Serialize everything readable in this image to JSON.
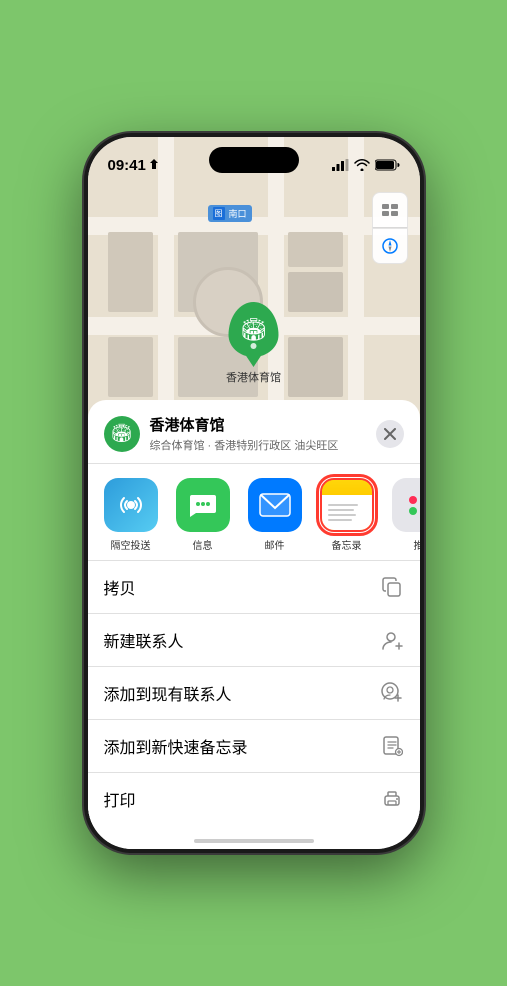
{
  "status": {
    "time": "09:41",
    "location_arrow": true
  },
  "map": {
    "sign_text": "南口",
    "marker_label": "香港体育馆",
    "controls": [
      "map-type-icon",
      "location-icon"
    ]
  },
  "location_card": {
    "name": "香港体育馆",
    "subtitle": "综合体育馆 · 香港特别行政区 油尖旺区",
    "close_label": "×"
  },
  "share_items": [
    {
      "id": "airdrop",
      "label": "隔空投送",
      "icon_type": "airdrop"
    },
    {
      "id": "messages",
      "label": "信息",
      "icon_type": "messages"
    },
    {
      "id": "mail",
      "label": "邮件",
      "icon_type": "mail"
    },
    {
      "id": "notes",
      "label": "备忘录",
      "icon_type": "notes",
      "selected": true
    },
    {
      "id": "more",
      "label": "推",
      "icon_type": "more"
    }
  ],
  "actions": [
    {
      "id": "copy",
      "label": "拷贝",
      "icon": "copy"
    },
    {
      "id": "new-contact",
      "label": "新建联系人",
      "icon": "person-add"
    },
    {
      "id": "add-existing",
      "label": "添加到现有联系人",
      "icon": "person-circle-add"
    },
    {
      "id": "add-note",
      "label": "添加到新快速备忘录",
      "icon": "note-add"
    },
    {
      "id": "print",
      "label": "打印",
      "icon": "printer"
    }
  ]
}
